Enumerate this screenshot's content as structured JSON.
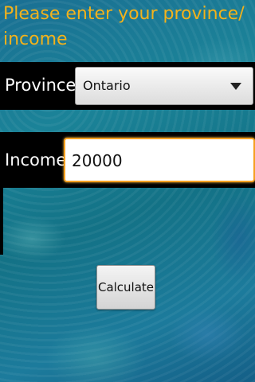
{
  "header": {
    "title": "Please enter your province/ income"
  },
  "form": {
    "province_label": "Province:",
    "province_value": "Ontario",
    "income_label": "Income:",
    "income_value": "20000"
  },
  "actions": {
    "calculate_label": "Calculate"
  },
  "colors": {
    "title": "#f3b21b",
    "field_focus_border": "#f5a020",
    "label_band": "#000000",
    "background": "#1b7b96"
  },
  "icons": {
    "spinner_arrow": "dropdown-arrow-icon"
  }
}
